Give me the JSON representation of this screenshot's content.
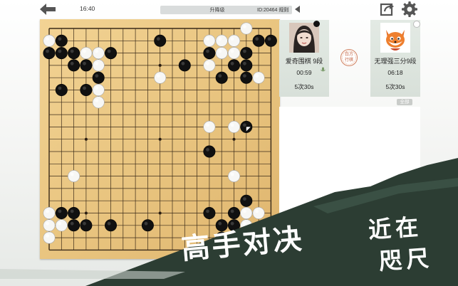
{
  "header": {
    "time": "16:40",
    "title": "升降级",
    "match_id": "ID:20464  规则",
    "icons": [
      "back-arrow-icon",
      "collapse-arrow-icon",
      "share-icon",
      "gear-icon"
    ]
  },
  "board": {
    "size": 19,
    "black_stones": [
      [
        1,
        1
      ],
      [
        2,
        3
      ],
      [
        1,
        2
      ],
      [
        0,
        2
      ],
      [
        2,
        2
      ],
      [
        3,
        3
      ],
      [
        4,
        4
      ],
      [
        3,
        5
      ],
      [
        1,
        5
      ],
      [
        5,
        2
      ],
      [
        9,
        1
      ],
      [
        11,
        3
      ],
      [
        13,
        2
      ],
      [
        15,
        3
      ],
      [
        16,
        3
      ],
      [
        17,
        1
      ],
      [
        16,
        2
      ],
      [
        18,
        1
      ],
      [
        16,
        4
      ],
      [
        14,
        4
      ],
      [
        16,
        8
      ],
      [
        13,
        10
      ],
      [
        16,
        14
      ],
      [
        15,
        15
      ],
      [
        14,
        16
      ],
      [
        13,
        15
      ],
      [
        15,
        16
      ],
      [
        1,
        15
      ],
      [
        2,
        16
      ],
      [
        2,
        15
      ],
      [
        3,
        16
      ],
      [
        5,
        16
      ],
      [
        8,
        16
      ],
      [
        14,
        17
      ]
    ],
    "white_stones": [
      [
        1,
        15
      ],
      [
        0,
        15
      ],
      [
        0,
        16
      ],
      [
        1,
        16
      ],
      [
        0,
        17
      ],
      [
        2,
        12
      ],
      [
        4,
        2
      ],
      [
        4,
        3
      ],
      [
        4,
        4
      ],
      [
        4,
        5
      ],
      [
        4,
        6
      ],
      [
        3,
        2
      ],
      [
        2,
        2
      ],
      [
        0,
        1
      ],
      [
        1,
        1
      ],
      [
        5,
        2
      ],
      [
        9,
        4
      ],
      [
        13,
        1
      ],
      [
        14,
        1
      ],
      [
        15,
        1
      ],
      [
        16,
        2
      ],
      [
        13,
        2
      ],
      [
        14,
        2
      ],
      [
        15,
        2
      ],
      [
        13,
        3
      ],
      [
        16,
        0
      ],
      [
        17,
        4
      ],
      [
        13,
        8
      ],
      [
        15,
        8
      ],
      [
        13,
        10
      ],
      [
        15,
        12
      ],
      [
        13,
        15
      ],
      [
        15,
        15
      ],
      [
        16,
        15
      ],
      [
        17,
        15
      ],
      [
        16,
        16
      ],
      [
        15,
        17
      ]
    ],
    "last_move": [
      16,
      8
    ],
    "star_points": [
      [
        3,
        3
      ],
      [
        9,
        3
      ],
      [
        15,
        3
      ],
      [
        3,
        9
      ],
      [
        9,
        9
      ],
      [
        15,
        9
      ],
      [
        3,
        15
      ],
      [
        9,
        15
      ],
      [
        15,
        15
      ]
    ]
  },
  "players": {
    "black": {
      "name": "爱奇围棋 9段",
      "clock": "00:59",
      "byoyomi": "5次30s",
      "stone": "black"
    },
    "white": {
      "name": "无理强三分9段",
      "clock": "06:18",
      "byoyomi": "5次30s",
      "stone": "white"
    },
    "komi_badge": "白方行棋"
  },
  "chat": {
    "tab_label": "全部"
  },
  "banner": {
    "line1": "高手对决",
    "line2": "近在",
    "line3": "咫尺",
    "color": "#2c3d33"
  }
}
